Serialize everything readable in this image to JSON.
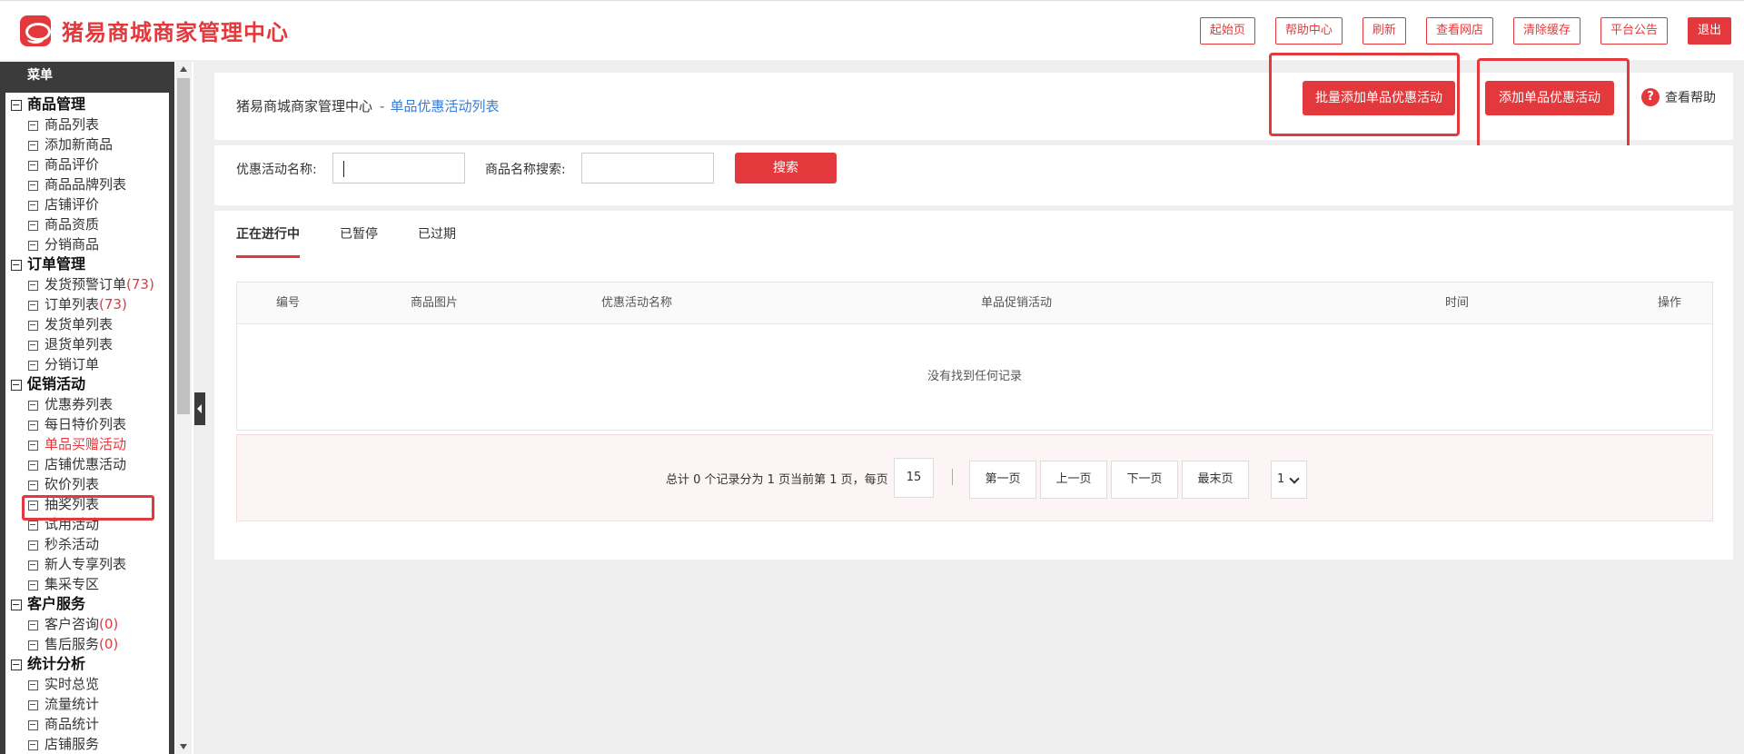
{
  "header": {
    "brand": "猪易商城商家管理中心",
    "nav": [
      "起始页",
      "帮助中心",
      "刷新",
      "查看网店",
      "清除缓存",
      "平台公告"
    ],
    "logout": "退出"
  },
  "sidebar": {
    "title": "菜单",
    "groups": [
      {
        "label": "商品管理",
        "items": [
          {
            "label": "商品列表"
          },
          {
            "label": "添加新商品"
          },
          {
            "label": "商品评价"
          },
          {
            "label": "商品品牌列表"
          },
          {
            "label": "店铺评价"
          },
          {
            "label": "商品资质"
          },
          {
            "label": "分销商品"
          }
        ]
      },
      {
        "label": "订单管理",
        "items": [
          {
            "label": "发货预警订单",
            "count": "(73)"
          },
          {
            "label": "订单列表",
            "count": "(73)"
          },
          {
            "label": "发货单列表"
          },
          {
            "label": "退货单列表"
          },
          {
            "label": "分销订单"
          }
        ]
      },
      {
        "label": "促销活动",
        "items": [
          {
            "label": "优惠券列表"
          },
          {
            "label": "每日特价列表"
          },
          {
            "label": "单品买赠活动",
            "active": true
          },
          {
            "label": "店铺优惠活动"
          },
          {
            "label": "砍价列表"
          },
          {
            "label": "抽奖列表"
          },
          {
            "label": "试用活动"
          },
          {
            "label": "秒杀活动"
          },
          {
            "label": "新人专享列表"
          },
          {
            "label": "集采专区"
          }
        ]
      },
      {
        "label": "客户服务",
        "items": [
          {
            "label": "客户咨询",
            "count": "(0)"
          },
          {
            "label": "售后服务",
            "count": "(0)"
          }
        ]
      },
      {
        "label": "统计分析",
        "items": [
          {
            "label": "实时总览"
          },
          {
            "label": "流量统计"
          },
          {
            "label": "商品统计"
          },
          {
            "label": "店铺服务"
          }
        ]
      }
    ]
  },
  "page": {
    "breadcrumb_root": "猪易商城商家管理中心",
    "breadcrumb_sep": "-",
    "breadcrumb_current": "单品优惠活动列表",
    "batch_add_button": "批量添加单品优惠活动",
    "add_button": "添加单品优惠活动",
    "help_icon": "?",
    "help_label": "查看帮助"
  },
  "search": {
    "activity_label": "优惠活动名称:",
    "activity_value": "",
    "product_label": "商品名称搜索:",
    "product_value": "",
    "button": "搜索"
  },
  "tabs": [
    "正在进行中",
    "已暂停",
    "已过期"
  ],
  "table": {
    "columns": [
      "编号",
      "商品图片",
      "优惠活动名称",
      "单品促销活动",
      "时间",
      "操作"
    ],
    "empty_text": "没有找到任何记录"
  },
  "pagination": {
    "info": "总计 0 个记录分为 1 页当前第 1 页，每页",
    "page_size": "15",
    "first": "第一页",
    "prev": "上一页",
    "next": "下一页",
    "last": "最末页",
    "page_select": "1"
  },
  "colors": {
    "accent": "#e4393c",
    "link": "#3a7bd5",
    "sidebar_dark": "#3b3b3b"
  }
}
